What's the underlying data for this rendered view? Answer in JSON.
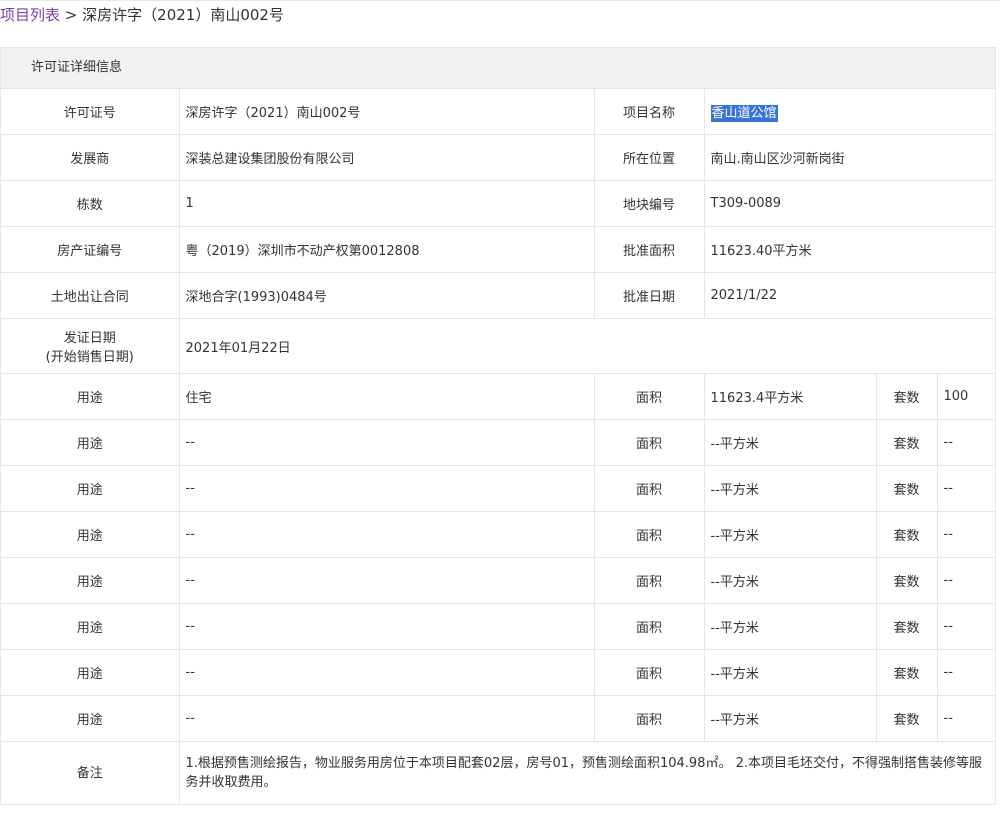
{
  "breadcrumb": {
    "link": "项目列表",
    "separator": ">",
    "current": "深房许字（2021）南山002号"
  },
  "panel": {
    "title": "许可证详细信息"
  },
  "info": {
    "license_no_label": "许可证号",
    "license_no": "深房许字（2021）南山002号",
    "project_name_label": "项目名称",
    "project_name": "香山道公馆",
    "developer_label": "发展商",
    "developer": "深装总建设集团股份有限公司",
    "location_label": "所在位置",
    "location": "南山.南山区沙河新岗街",
    "buildings_label": "栋数",
    "buildings": "1",
    "parcel_label": "地块编号",
    "parcel": "T309-0089",
    "cert_label": "房产证编号",
    "cert": "粤（2019）深圳市不动产权第0012808",
    "approved_area_label": "批准面积",
    "approved_area": "11623.40平方米",
    "land_contract_label": "土地出让合同",
    "land_contract": "深地合字(1993)0484号",
    "approved_date_label": "批准日期",
    "approved_date": "2021/1/22",
    "issue_date_label_1": "发证日期",
    "issue_date_label_2": "(开始销售日期)",
    "issue_date": "2021年01月22日"
  },
  "usage_rows": [
    {
      "use_label": "用途",
      "use": "住宅",
      "area_label": "面积",
      "area": "11623.4平方米",
      "units_label": "套数",
      "units": "100"
    },
    {
      "use_label": "用途",
      "use": "--",
      "area_label": "面积",
      "area": "--平方米",
      "units_label": "套数",
      "units": "--"
    },
    {
      "use_label": "用途",
      "use": "--",
      "area_label": "面积",
      "area": "--平方米",
      "units_label": "套数",
      "units": "--"
    },
    {
      "use_label": "用途",
      "use": "--",
      "area_label": "面积",
      "area": "--平方米",
      "units_label": "套数",
      "units": "--"
    },
    {
      "use_label": "用途",
      "use": "--",
      "area_label": "面积",
      "area": "--平方米",
      "units_label": "套数",
      "units": "--"
    },
    {
      "use_label": "用途",
      "use": "--",
      "area_label": "面积",
      "area": "--平方米",
      "units_label": "套数",
      "units": "--"
    },
    {
      "use_label": "用途",
      "use": "--",
      "area_label": "面积",
      "area": "--平方米",
      "units_label": "套数",
      "units": "--"
    },
    {
      "use_label": "用途",
      "use": "--",
      "area_label": "面积",
      "area": "--平方米",
      "units_label": "套数",
      "units": "--"
    }
  ],
  "remark": {
    "label": "备注",
    "text": "1.根据预售测绘报告，物业服务用房位于本项目配套02层，房号01，预售测绘面积104.98㎡。 2.本项目毛坯交付，不得强制搭售装修等服务并收取费用。"
  },
  "colors": {
    "link": "#7b3fa3",
    "highlight": "#3874d8",
    "header_bg": "#f2f2f2",
    "border": "#e6e6e6"
  }
}
